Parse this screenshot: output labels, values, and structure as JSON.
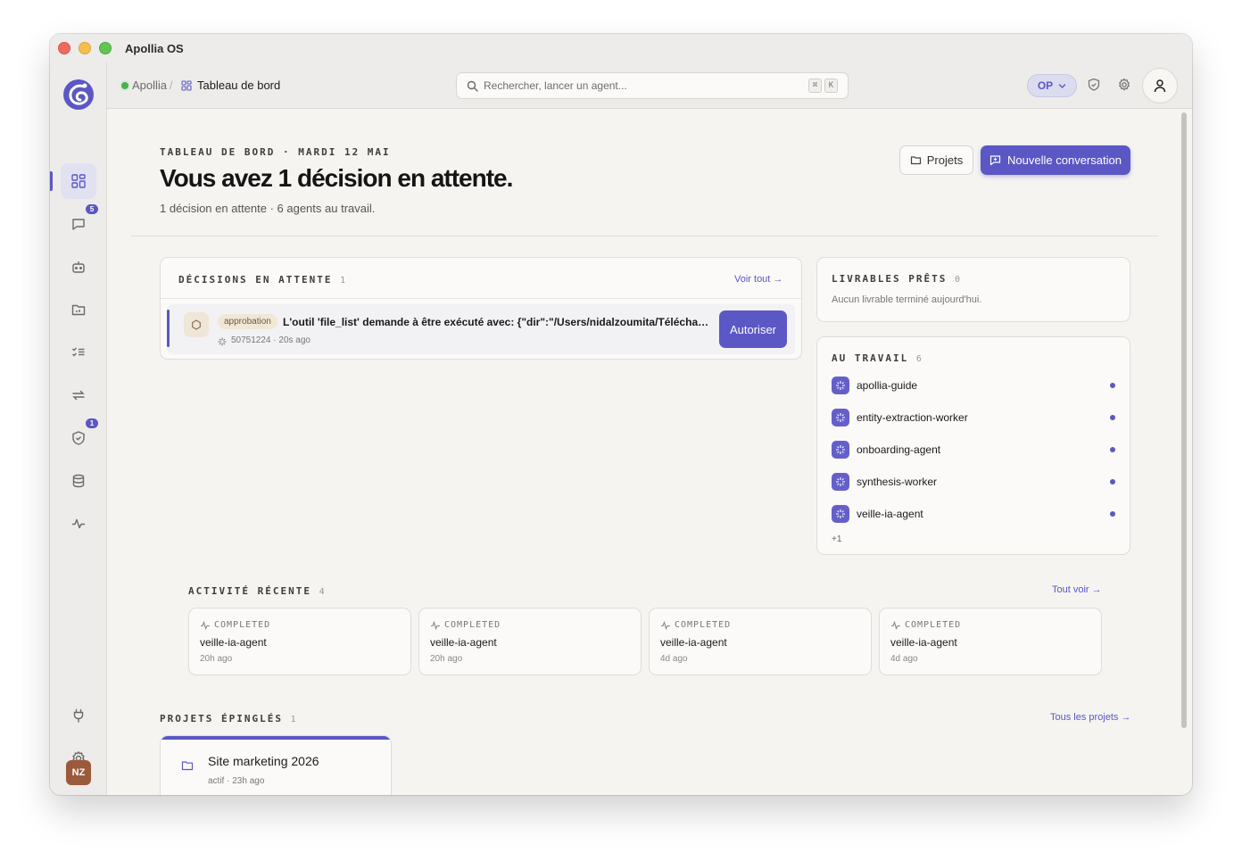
{
  "window": {
    "title": "Apollia OS"
  },
  "breadcrumb": {
    "home": "Apollia",
    "separator": "/",
    "current": "Tableau de bord"
  },
  "search": {
    "placeholder": "Rechercher, lancer un agent...",
    "value": "",
    "shortcut": [
      "⌘",
      "K"
    ]
  },
  "topbar": {
    "org_label": "OP"
  },
  "sidebar": {
    "items": [
      {
        "name": "dashboard",
        "icon": "grid-icon",
        "active": true
      },
      {
        "name": "conversations",
        "icon": "chat-icon",
        "badge": "5"
      },
      {
        "name": "agents",
        "icon": "robot-icon"
      },
      {
        "name": "projects",
        "icon": "folder-chart-icon"
      },
      {
        "name": "tasks",
        "icon": "checklist-icon"
      },
      {
        "name": "workflows",
        "icon": "repeat-icon"
      },
      {
        "name": "approvals",
        "icon": "shield-check-icon",
        "badge": "1"
      },
      {
        "name": "data",
        "icon": "database-icon"
      },
      {
        "name": "activity",
        "icon": "pulse-icon"
      }
    ],
    "bottom": [
      {
        "name": "integrations",
        "icon": "plug-icon"
      },
      {
        "name": "settings",
        "icon": "gear-icon"
      }
    ],
    "avatar_initials": "NZ"
  },
  "hero": {
    "eyebrow": "TABLEAU DE BORD · MARDI 12 MAI",
    "title": "Vous avez 1 décision en attente.",
    "subtitle": "1 décision en attente · 6 agents au travail.",
    "projets_button": "Projets",
    "new_conversation_button": "Nouvelle conversation"
  },
  "decisions": {
    "title": "DÉCISIONS EN ATTENTE",
    "count": "1",
    "view_all": "Voir tout →",
    "items": [
      {
        "tag": "approbation",
        "text": "L'outil 'file_list' demande à être exécuté avec: {\"dir\":\"/Users/nidalzoumita/Téléchar...",
        "meta": "50751224 · 20s ago",
        "action": "Autoriser"
      }
    ]
  },
  "livrables": {
    "title": "LIVRABLES PRÊTS",
    "count": "0",
    "empty": "Aucun livrable terminé aujourd'hui."
  },
  "au_travail": {
    "title": "AU TRAVAIL",
    "count": "6",
    "agents": [
      "apollia-guide",
      "entity-extraction-worker",
      "onboarding-agent",
      "synthesis-worker",
      "veille-ia-agent"
    ],
    "more": "+1"
  },
  "activite": {
    "title": "ACTIVITÉ RÉCENTE",
    "count": "4",
    "view_all": "Tout voir →",
    "items": [
      {
        "status": "COMPLETED",
        "agent": "veille-ia-agent",
        "time": "20h ago"
      },
      {
        "status": "COMPLETED",
        "agent": "veille-ia-agent",
        "time": "20h ago"
      },
      {
        "status": "COMPLETED",
        "agent": "veille-ia-agent",
        "time": "4d ago"
      },
      {
        "status": "COMPLETED",
        "agent": "veille-ia-agent",
        "time": "4d ago"
      }
    ]
  },
  "projets": {
    "title": "PROJETS ÉPINGLÉS",
    "count": "1",
    "view_all": "Tous les projets →",
    "items": [
      {
        "name": "Site marketing 2026",
        "meta": "actif · 23h ago"
      }
    ]
  },
  "colors": {
    "accent": "#5b57c4",
    "background": "#f5f4f1",
    "sidebar": "#edecea",
    "tag": "#f1e7d6"
  }
}
